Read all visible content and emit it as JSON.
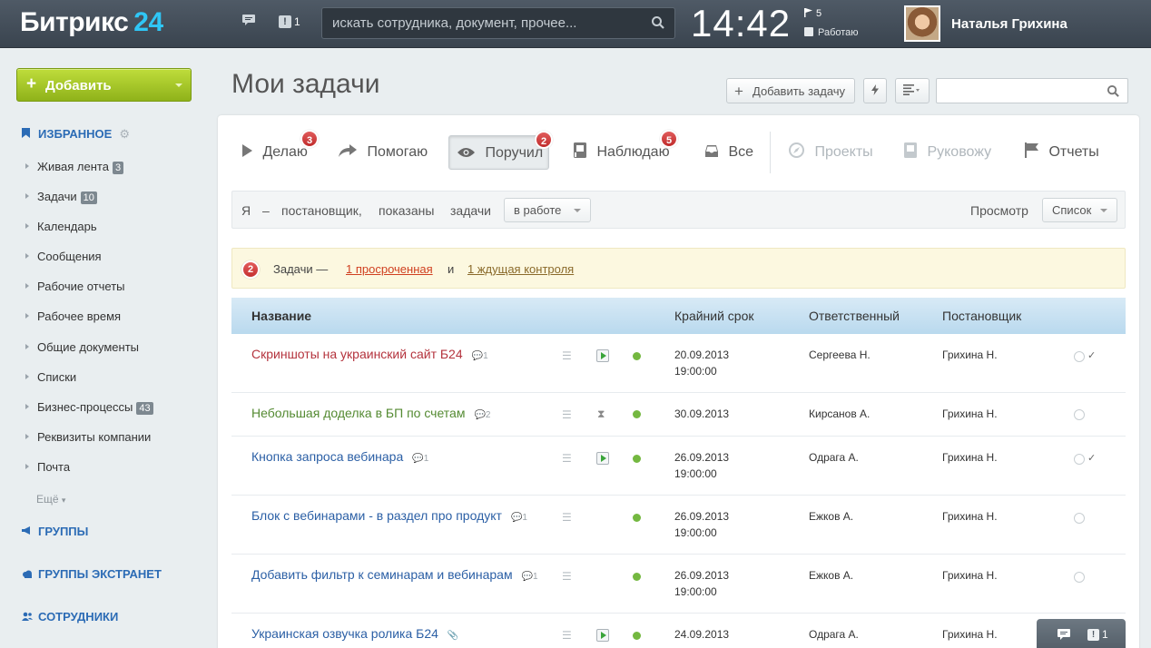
{
  "header": {
    "logo_text": "Битрикс",
    "logo_num": "24",
    "notifications_count": "1",
    "search_placeholder": "искать сотрудника, документ, прочее...",
    "clock": "14:42",
    "flags_count": "5",
    "work_status": "Работаю",
    "user_name": "Наталья Грихина"
  },
  "sidebar": {
    "add_button": "Добавить",
    "favorites": "ИЗБРАННОЕ",
    "items": [
      {
        "label": "Живая лента",
        "badge": "3"
      },
      {
        "label": "Задачи",
        "badge": "10"
      },
      {
        "label": "Календарь",
        "badge": ""
      },
      {
        "label": "Сообщения",
        "badge": ""
      },
      {
        "label": "Рабочие отчеты",
        "badge": ""
      },
      {
        "label": "Рабочее время",
        "badge": ""
      },
      {
        "label": "Общие документы",
        "badge": ""
      },
      {
        "label": "Списки",
        "badge": ""
      },
      {
        "label": "Бизнес-процессы",
        "badge": "43"
      },
      {
        "label": "Реквизиты компании",
        "badge": ""
      },
      {
        "label": "Почта",
        "badge": ""
      }
    ],
    "more": "Ещё",
    "groups": "ГРУППЫ",
    "extranet": "ГРУППЫ ЭКСТРАНЕТ",
    "employees": "СОТРУДНИКИ"
  },
  "page": {
    "title": "Мои задачи",
    "add_task": "Добавить задачу"
  },
  "tabs": [
    {
      "label": "Делаю",
      "count": "3"
    },
    {
      "label": "Помогаю",
      "count": ""
    },
    {
      "label": "Поручил",
      "count": "2"
    },
    {
      "label": "Наблюдаю",
      "count": "5"
    },
    {
      "label": "Все",
      "count": ""
    },
    {
      "label": "Проекты",
      "count": ""
    },
    {
      "label": "Руковожу",
      "count": ""
    },
    {
      "label": "Отчеты",
      "count": ""
    }
  ],
  "filter": {
    "w1": "Я",
    "w2": "–",
    "w3": "постановщик,",
    "w4": "показаны",
    "w5": "задачи",
    "status": "в работе",
    "view_label": "Просмотр",
    "view_mode": "Список"
  },
  "notice": {
    "count": "2",
    "prefix": "Задачи —",
    "link1": "1 просроченная",
    "and": "и",
    "link2": "1 ждущая контроля"
  },
  "table": {
    "headers": {
      "name": "Название",
      "deadline": "Крайний срок",
      "responsible": "Ответственный",
      "creator": "Постановщик"
    },
    "rows": [
      {
        "title": "Скриншоты на украинский сайт Б24",
        "comments": "1",
        "date": "20.09.2013",
        "time": "19:00:00",
        "responsible": "Сергеева Н.",
        "creator": "Грихина Н."
      },
      {
        "title": "Небольшая доделка в БП по счетам",
        "comments": "2",
        "date": "30.09.2013",
        "time": "",
        "responsible": "Кирсанов А.",
        "creator": "Грихина Н."
      },
      {
        "title": "Кнопка запроса вебинара",
        "comments": "1",
        "date": "26.09.2013",
        "time": "19:00:00",
        "responsible": "Одрага А.",
        "creator": "Грихина Н."
      },
      {
        "title": "Блок с вебинарами - в раздел про продукт",
        "comments": "1",
        "date": "26.09.2013",
        "time": "19:00:00",
        "responsible": "Ежков А.",
        "creator": "Грихина Н."
      },
      {
        "title": "Добавить фильтр к семинарам и вебинарам",
        "comments": "1",
        "date": "26.09.2013",
        "time": "19:00:00",
        "responsible": "Ежков А.",
        "creator": "Грихина Н."
      },
      {
        "title": "Украинская озвучка ролика Б24",
        "comments": "",
        "date": "24.09.2013",
        "time": "",
        "responsible": "Одрага А.",
        "creator": "Грихина Н."
      }
    ]
  },
  "chat": {
    "count": "1"
  },
  "colors": {
    "accent": "#2fc6f6",
    "add_button": "#9dc32a",
    "overdue_title": "#b4333d",
    "link": "#2b5fa5",
    "badge_red": "#c53030"
  }
}
